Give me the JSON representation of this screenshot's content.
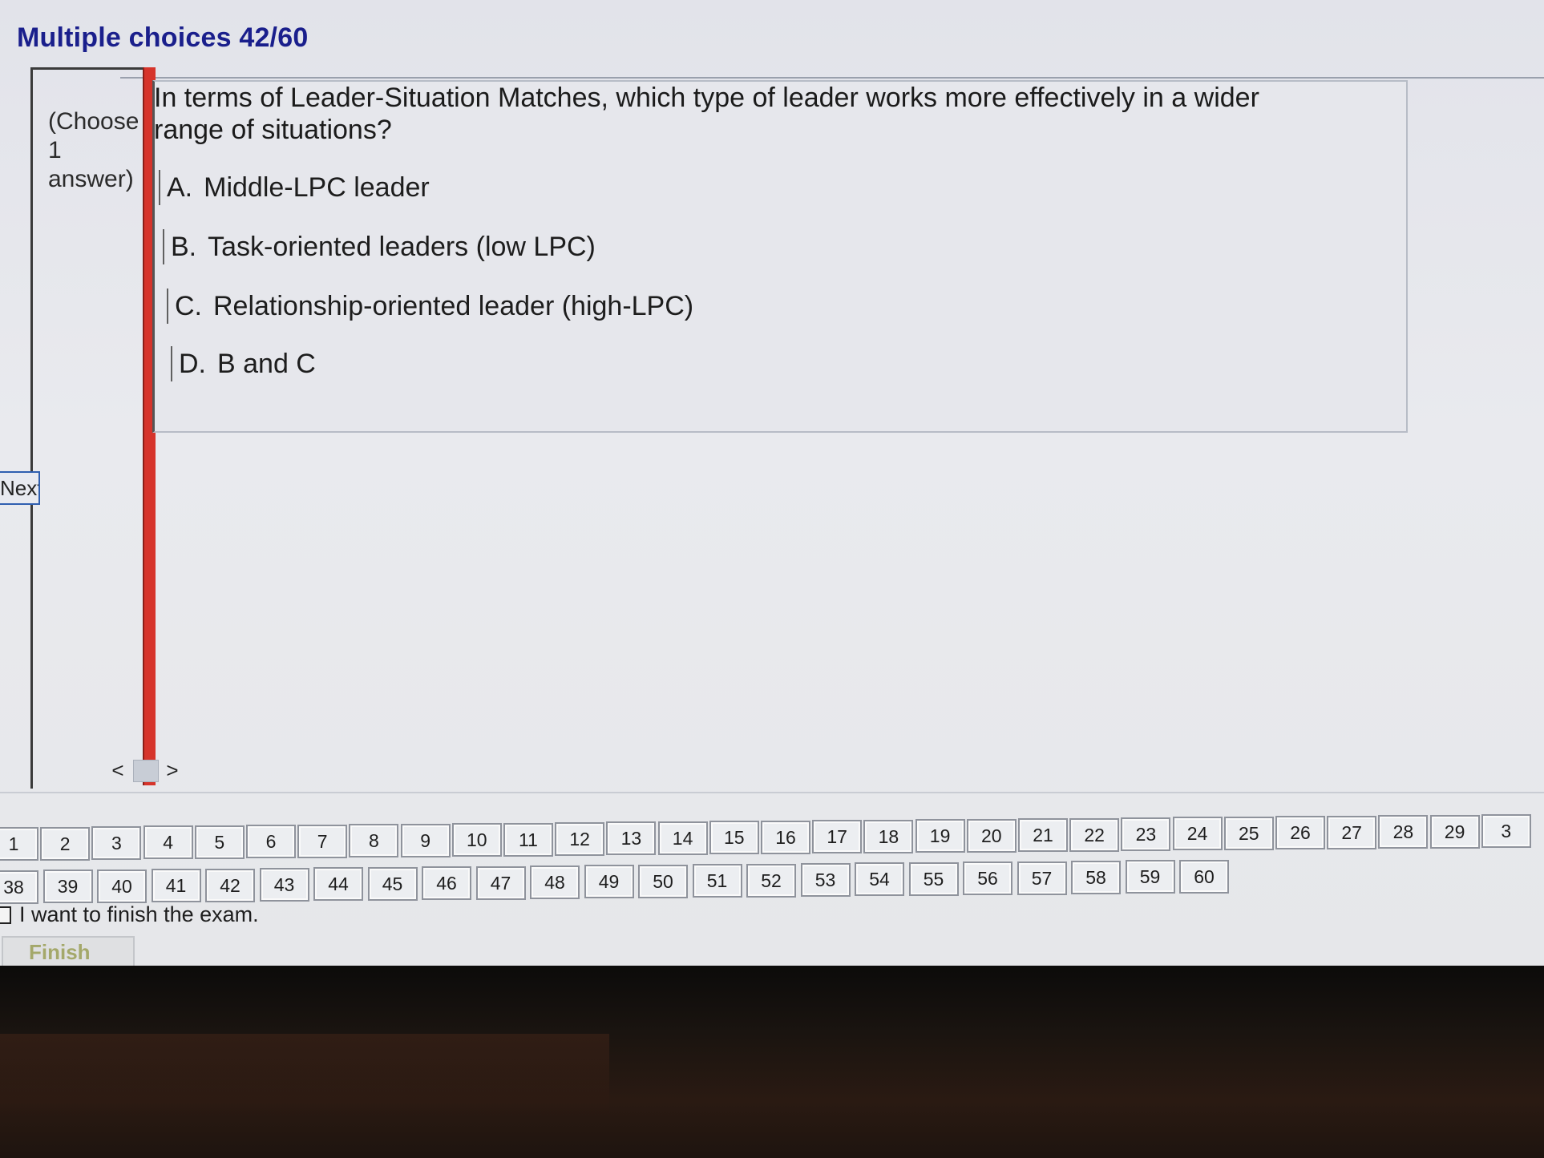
{
  "header": {
    "title": "Multiple choices 42/60"
  },
  "question": {
    "hint": "(Choose\n1\nanswer)",
    "text": "In terms of Leader-Situation Matches, which type of leader works more effectively in a wider range of situations?",
    "options": [
      {
        "letter": "A.",
        "label": "Middle-LPC leader"
      },
      {
        "letter": "B.",
        "label": "Task-oriented leaders (low LPC)"
      },
      {
        "letter": "C.",
        "label": "Relationship-oriented leader (high-LPC)"
      },
      {
        "letter": "D.",
        "label": "B and C"
      }
    ]
  },
  "nav": {
    "prev": "<",
    "next": ">",
    "next_button_label": "Next"
  },
  "question_numbers": [
    "1",
    "2",
    "3",
    "4",
    "5",
    "6",
    "7",
    "8",
    "9",
    "10",
    "11",
    "12",
    "13",
    "14",
    "15",
    "16",
    "17",
    "18",
    "19",
    "20",
    "21",
    "22",
    "23",
    "24",
    "25",
    "26",
    "27",
    "28",
    "29",
    "3",
    "38",
    "39",
    "40",
    "41",
    "42",
    "43",
    "44",
    "45",
    "46",
    "47",
    "48",
    "49",
    "50",
    "51",
    "52",
    "53",
    "54",
    "55",
    "56",
    "57",
    "58",
    "59",
    "60"
  ],
  "finish": {
    "checkbox_label": "I want to finish the exam.",
    "button_label": "Finish"
  }
}
